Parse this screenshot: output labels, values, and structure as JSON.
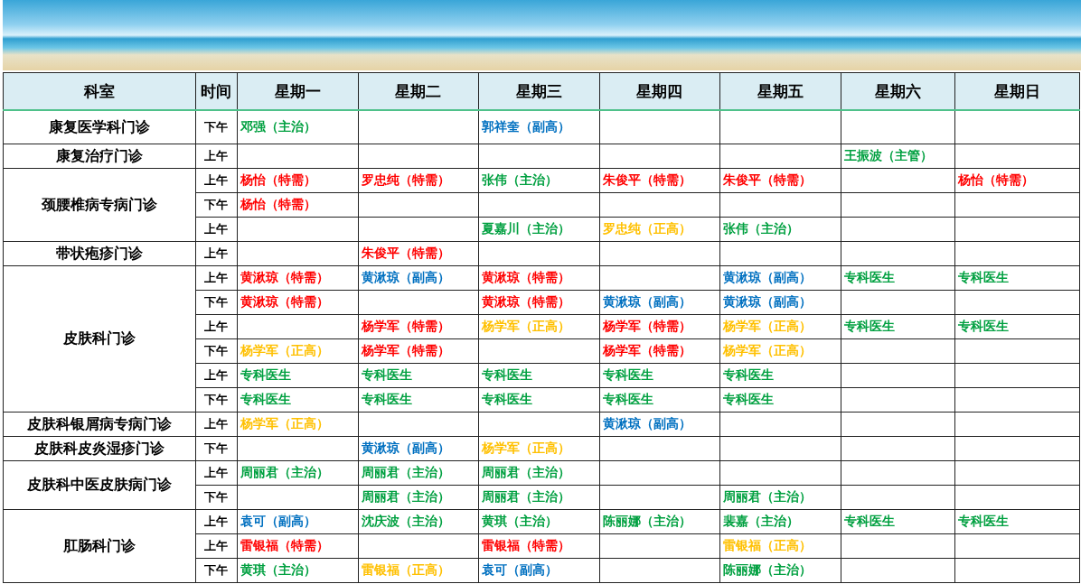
{
  "table": {
    "columns": [
      "科室",
      "时间",
      "星期一",
      "星期二",
      "星期三",
      "星期四",
      "星期五",
      "星期六",
      "星期日"
    ],
    "departments": [
      {
        "name": "康复医学科门诊",
        "sessions": [
          {
            "time": "下午",
            "cells": [
              {
                "text": "邓强（主治）",
                "color": "#00a040"
              },
              null,
              {
                "text": "郭祥奎（副高）",
                "color": "#0070c0"
              },
              null,
              null,
              null,
              null
            ]
          }
        ]
      },
      {
        "name": "康复治疗门诊",
        "sessions": [
          {
            "time": "上午",
            "cells": [
              null,
              null,
              null,
              null,
              null,
              {
                "text": "王振波（主管）",
                "color": "#00a040"
              },
              null
            ]
          }
        ]
      },
      {
        "name": "颈腰椎病专病门诊",
        "sessions": [
          {
            "time": "上午",
            "cells": [
              {
                "text": "杨怡（特需）",
                "color": "#ff0000"
              },
              {
                "text": "罗忠纯（特需）",
                "color": "#ff0000"
              },
              {
                "text": "张伟（主治）",
                "color": "#00a040"
              },
              {
                "text": "朱俊平（特需）",
                "color": "#ff0000"
              },
              {
                "text": "朱俊平（特需）",
                "color": "#ff0000"
              },
              null,
              {
                "text": "杨怡（特需）",
                "color": "#ff0000"
              }
            ]
          },
          {
            "time": "下午",
            "cells": [
              {
                "text": "杨怡（特需）",
                "color": "#ff0000"
              },
              null,
              null,
              null,
              null,
              null,
              null
            ]
          },
          {
            "time": "上午",
            "cells": [
              null,
              null,
              {
                "text": "夏嘉川（主治）",
                "color": "#00a040"
              },
              {
                "text": "罗忠纯（正高）",
                "color": "#ffc000"
              },
              {
                "text": "张伟（主治）",
                "color": "#00a040"
              },
              null,
              null
            ]
          }
        ]
      },
      {
        "name": "带状疱疹门诊",
        "sessions": [
          {
            "time": "上午",
            "cells": [
              null,
              {
                "text": "朱俊平（特需）",
                "color": "#ff0000"
              },
              null,
              null,
              null,
              null,
              null
            ]
          }
        ]
      },
      {
        "name": "皮肤科门诊",
        "sessions": [
          {
            "time": "上午",
            "cells": [
              {
                "text": "黄湫琼（特需）",
                "color": "#ff0000"
              },
              {
                "text": "黄湫琼（副高）",
                "color": "#0070c0"
              },
              {
                "text": "黄湫琼（特需）",
                "color": "#ff0000"
              },
              null,
              {
                "text": "黄湫琼（副高）",
                "color": "#0070c0"
              },
              {
                "text": "专科医生",
                "color": "#00a040"
              },
              {
                "text": "专科医生",
                "color": "#00a040"
              }
            ]
          },
          {
            "time": "下午",
            "cells": [
              {
                "text": "黄湫琼（特需）",
                "color": "#ff0000"
              },
              null,
              {
                "text": "黄湫琼（特需）",
                "color": "#ff0000"
              },
              {
                "text": "黄湫琼（副高）",
                "color": "#0070c0"
              },
              {
                "text": "黄湫琼（副高）",
                "color": "#0070c0"
              },
              null,
              null
            ]
          },
          {
            "time": "上午",
            "cells": [
              null,
              {
                "text": "杨学军（特需）",
                "color": "#ff0000"
              },
              {
                "text": "杨学军（正高）",
                "color": "#ffc000"
              },
              {
                "text": "杨学军（特需）",
                "color": "#ff0000"
              },
              {
                "text": "杨学军（正高）",
                "color": "#ffc000"
              },
              {
                "text": "专科医生",
                "color": "#00a040"
              },
              {
                "text": "专科医生",
                "color": "#00a040"
              }
            ]
          },
          {
            "time": "下午",
            "cells": [
              {
                "text": "杨学军（正高）",
                "color": "#ffc000"
              },
              {
                "text": "杨学军（特需）",
                "color": "#ff0000"
              },
              null,
              {
                "text": "杨学军（特需）",
                "color": "#ff0000"
              },
              {
                "text": "杨学军（正高）",
                "color": "#ffc000"
              },
              null,
              null
            ]
          },
          {
            "time": "上午",
            "cells": [
              {
                "text": "专科医生",
                "color": "#00a040"
              },
              {
                "text": "专科医生",
                "color": "#00a040"
              },
              {
                "text": "专科医生",
                "color": "#00a040"
              },
              {
                "text": "专科医生",
                "color": "#00a040"
              },
              {
                "text": "专科医生",
                "color": "#00a040"
              },
              null,
              null
            ]
          },
          {
            "time": "下午",
            "cells": [
              {
                "text": "专科医生",
                "color": "#00a040"
              },
              {
                "text": "专科医生",
                "color": "#00a040"
              },
              {
                "text": "专科医生",
                "color": "#00a040"
              },
              {
                "text": "专科医生",
                "color": "#00a040"
              },
              {
                "text": "专科医生",
                "color": "#00a040"
              },
              null,
              null
            ]
          }
        ]
      },
      {
        "name": "皮肤科银屑病专病门诊",
        "sessions": [
          {
            "time": "上午",
            "cells": [
              {
                "text": "杨学军（正高）",
                "color": "#ffc000"
              },
              null,
              null,
              {
                "text": "黄湫琼（副高）",
                "color": "#0070c0"
              },
              null,
              null,
              null
            ]
          }
        ]
      },
      {
        "name": "皮肤科皮炎湿疹门诊",
        "sessions": [
          {
            "time": "下午",
            "cells": [
              null,
              {
                "text": "黄湫琼（副高）",
                "color": "#0070c0"
              },
              {
                "text": "杨学军（正高）",
                "color": "#ffc000"
              },
              null,
              null,
              null,
              null
            ]
          }
        ]
      },
      {
        "name": "皮肤科中医皮肤病门诊",
        "sessions": [
          {
            "time": "上午",
            "cells": [
              {
                "text": "周丽君（主治）",
                "color": "#00a040"
              },
              {
                "text": "周丽君（主治）",
                "color": "#00a040"
              },
              {
                "text": "周丽君（主治）",
                "color": "#00a040"
              },
              null,
              null,
              null,
              null
            ]
          },
          {
            "time": "下午",
            "cells": [
              null,
              {
                "text": "周丽君（主治）",
                "color": "#00a040"
              },
              {
                "text": "周丽君（主治）",
                "color": "#00a040"
              },
              null,
              {
                "text": "周丽君（主治）",
                "color": "#00a040"
              },
              null,
              null
            ]
          }
        ]
      },
      {
        "name": "肛肠科门诊",
        "sessions": [
          {
            "time": "上午",
            "cells": [
              {
                "text": "袁可（副高）",
                "color": "#0070c0"
              },
              {
                "text": "沈庆波（主治）",
                "color": "#00a040"
              },
              {
                "text": "黄琪（主治）",
                "color": "#00a040"
              },
              {
                "text": "陈丽娜（主治）",
                "color": "#00a040"
              },
              {
                "text": "裴嘉（主治）",
                "color": "#00a040"
              },
              {
                "text": "专科医生",
                "color": "#00a040"
              },
              {
                "text": "专科医生",
                "color": "#00a040"
              }
            ]
          },
          {
            "time": "上午",
            "cells": [
              {
                "text": "雷银福（特需）",
                "color": "#ff0000"
              },
              null,
              {
                "text": "雷银福（特需）",
                "color": "#ff0000"
              },
              null,
              {
                "text": "雷银福（正高）",
                "color": "#ffc000"
              },
              null,
              null
            ]
          },
          {
            "time": "下午",
            "cells": [
              {
                "text": "黄琪（主治）",
                "color": "#00a040"
              },
              {
                "text": "雷银福（正高）",
                "color": "#ffc000"
              },
              {
                "text": "袁可（副高）",
                "color": "#0070c0"
              },
              null,
              {
                "text": "陈丽娜（主治）",
                "color": "#00a040"
              },
              null,
              null
            ]
          }
        ]
      }
    ]
  }
}
